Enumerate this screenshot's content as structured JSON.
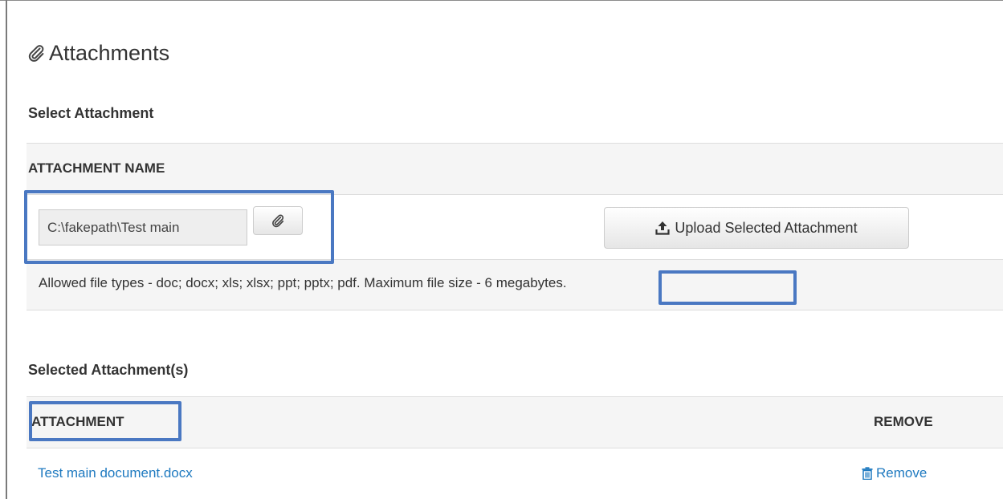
{
  "panel": {
    "title": "Attachments",
    "title_icon": "paperclip-icon"
  },
  "select_section": {
    "title": "Select Attachment",
    "column_header": "ATTACHMENT NAME",
    "file_input_value": "C:\\fakepath\\Test main",
    "browse_icon": "paperclip-icon",
    "upload_button_label": "Upload Selected Attachment",
    "upload_icon": "upload-icon",
    "allowed_types_text": "Allowed file types - doc; docx; xls; xlsx; ppt; pptx; pdf. Maximum file size - 6 megabytes."
  },
  "selected_section": {
    "title": "Selected Attachment(s)",
    "columns": [
      "ATTACHMENT",
      "REMOVE"
    ],
    "rows": [
      {
        "file_name": "Test main document.docx",
        "remove_label": "Remove",
        "remove_icon": "trash-icon"
      }
    ]
  },
  "colors": {
    "link": "#1f7ac0",
    "highlight": "#4a78c2",
    "shaded_row": "#f5f5f5"
  }
}
